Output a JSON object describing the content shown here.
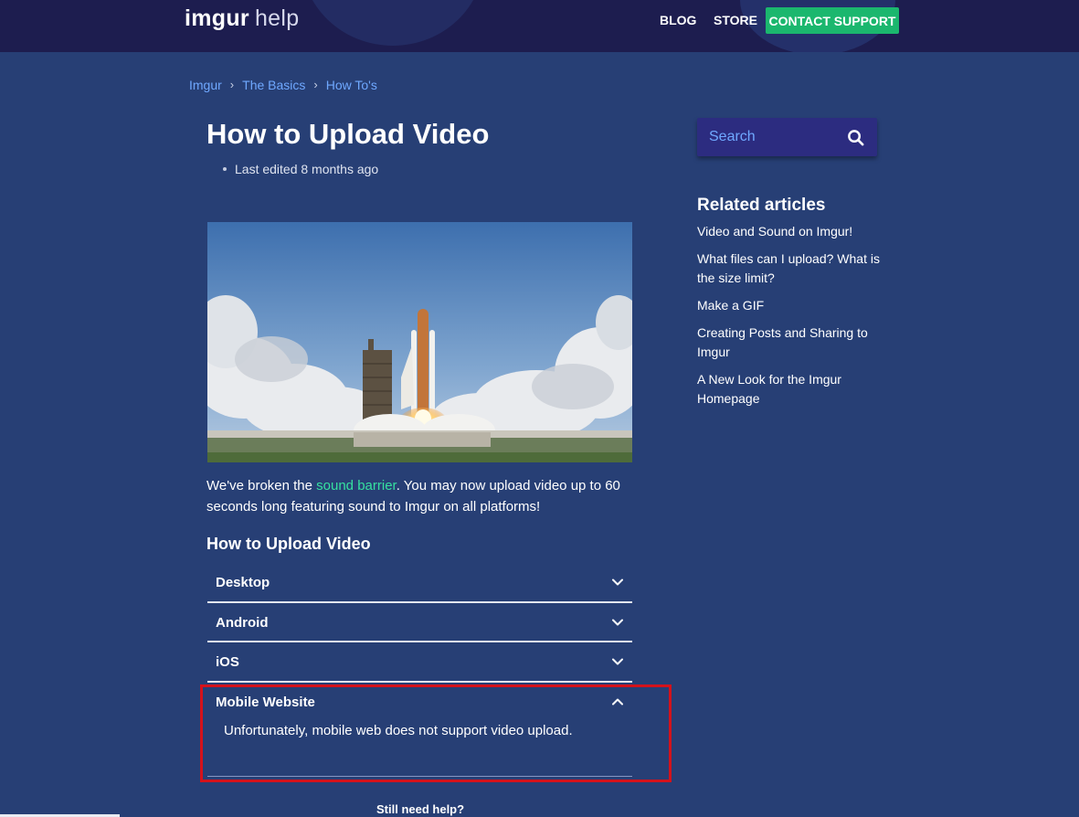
{
  "header": {
    "logo_brand": "imgur",
    "logo_sub": "help",
    "nav": {
      "blog": "BLOG",
      "store": "STORE",
      "contact": "CONTACT SUPPORT"
    }
  },
  "breadcrumb": [
    "Imgur",
    "The Basics",
    "How To's"
  ],
  "article": {
    "title": "How to Upload Video",
    "meta": "Last edited 8 months ago",
    "intro_before": "We've broken the ",
    "intro_link": "sound barrier",
    "intro_after": ". You may now upload video up to 60 seconds long featuring sound to Imgur on all platforms!",
    "section_title": "How to Upload Video",
    "accordion": [
      {
        "label": "Desktop"
      },
      {
        "label": "Android"
      },
      {
        "label": "iOS"
      },
      {
        "label": "Mobile Website",
        "body": "Unfortunately, mobile web does not support video upload."
      }
    ],
    "still_help": "Still need help?"
  },
  "sidebar": {
    "search_placeholder": "Search",
    "related_title": "Related articles",
    "related": [
      "Video and Sound on Imgur!",
      "What files can I upload? What is the size limit?",
      "Make a GIF",
      "Creating Posts and Sharing to Imgur",
      "A New Look for the Imgur Homepage"
    ]
  },
  "colors": {
    "page_bg": "#273f75",
    "header_bg": "#1d1d4f",
    "accent_green": "#1bb76e",
    "link_blue": "#6fa8ff",
    "highlight_red": "#d4121b"
  }
}
